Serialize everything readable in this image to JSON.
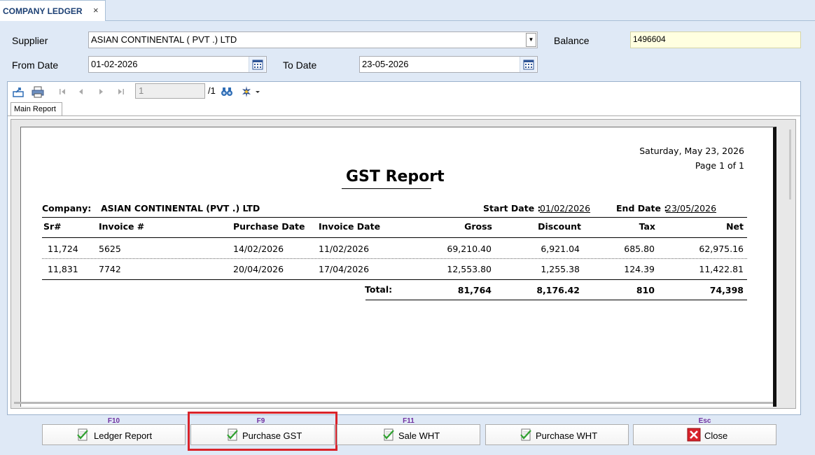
{
  "tab": {
    "title": "COMPANY LEDGER",
    "close": "×"
  },
  "form": {
    "supplier_label": "Supplier",
    "supplier_value": "ASIAN CONTINENTAL ( PVT .) LTD",
    "balance_label": "Balance",
    "balance_value": "1496604",
    "from_label": "From Date",
    "from_value": "01-02-2026",
    "to_label": "To Date",
    "to_value": "23-05-2026"
  },
  "viewer": {
    "page_value": "1",
    "page_total": "/1",
    "main_tab": "Main Report"
  },
  "report": {
    "date": "Saturday, May 23, 2026",
    "page": "Page 1 of 1",
    "title": "GST Report",
    "company_label": "Company:",
    "company_value": "ASIAN CONTINENTAL (PVT .) LTD",
    "start_label": "Start Date :",
    "start_value": "01/02/2026",
    "end_label": "End Date :",
    "end_value": "23/05/2026",
    "columns": [
      "Sr#",
      "Invoice #",
      "Purchase Date",
      "Invoice Date",
      "Gross",
      "Discount",
      "Tax",
      "Net"
    ],
    "rows": [
      [
        "11,724",
        "5625",
        "14/02/2026",
        "11/02/2026",
        "69,210.40",
        "6,921.04",
        "685.80",
        "62,975.16"
      ],
      [
        "11,831",
        "7742",
        "20/04/2026",
        "17/04/2026",
        "12,553.80",
        "1,255.38",
        "124.39",
        "11,422.81"
      ]
    ],
    "total_label": "Total:",
    "totals": [
      "81,764",
      "8,176.42",
      "810",
      "74,398"
    ]
  },
  "buttons": [
    {
      "key": "F10",
      "label": "Ledger Report",
      "icon": "check-document-icon"
    },
    {
      "key": "F9",
      "label": "Purchase GST",
      "icon": "check-document-icon"
    },
    {
      "key": "F11",
      "label": "Sale WHT",
      "icon": "check-document-icon"
    },
    {
      "key": "",
      "label": "Purchase WHT",
      "icon": "check-document-icon"
    },
    {
      "key": "Esc",
      "label": "Close",
      "icon": "close-x-icon"
    }
  ],
  "colors": {
    "accent": "#1b3f73",
    "highlight": "#d9232a",
    "fkey": "#7030a0",
    "balance_bg": "#ffffe0"
  }
}
